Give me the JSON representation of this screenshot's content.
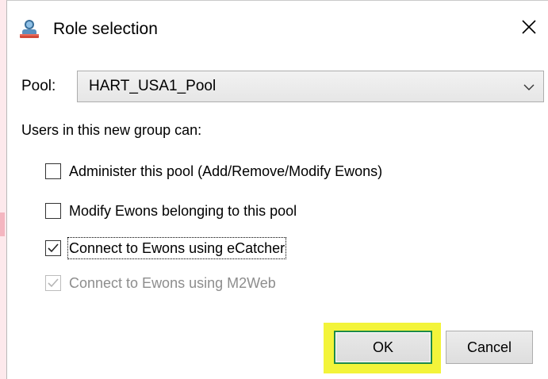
{
  "window": {
    "title": "Role selection",
    "close_glyph": "✕"
  },
  "pool": {
    "label": "Pool:",
    "selected": "HART_USA1_Pool"
  },
  "users_label": "Users in this new group can:",
  "permissions": [
    {
      "label": "Administer this pool (Add/Remove/Modify  Ewons)",
      "checked": false,
      "disabled": false
    },
    {
      "label": "Modify Ewons belonging to this pool",
      "checked": false,
      "disabled": false
    },
    {
      "label": "Connect to Ewons using eCatcher",
      "checked": true,
      "disabled": false,
      "focused": true
    },
    {
      "label": "Connect to Ewons using M2Web",
      "checked": true,
      "disabled": true
    }
  ],
  "buttons": {
    "ok": "OK",
    "cancel": "Cancel"
  },
  "colors": {
    "highlight": "#f3f43a",
    "ok_border": "#1e8a4a",
    "disabled_text": "#8d8d8d"
  },
  "icons": {
    "title": "users-group-icon",
    "close": "close-icon",
    "dropdown": "chevron-down-icon",
    "check": "checkmark-icon"
  }
}
